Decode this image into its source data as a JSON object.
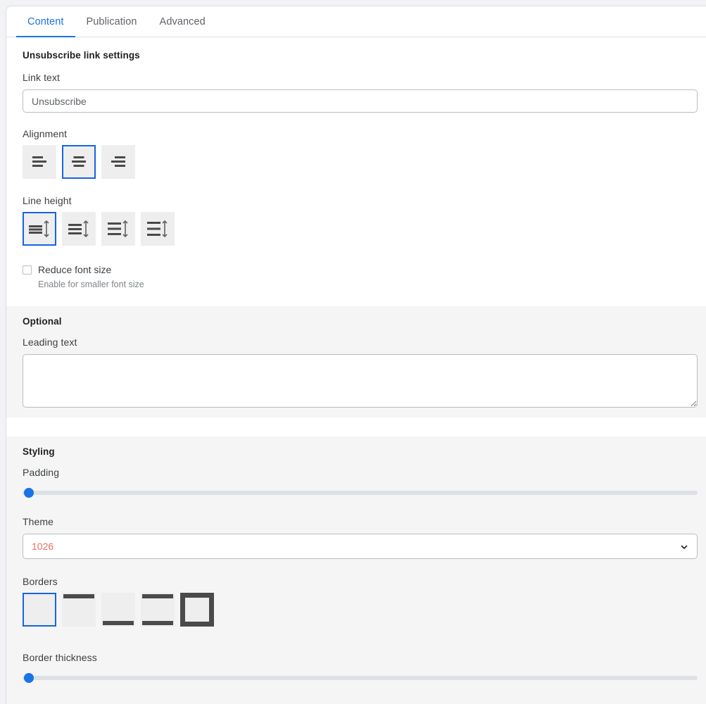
{
  "tabs": [
    {
      "label": "Content",
      "active": true
    },
    {
      "label": "Publication",
      "active": false
    },
    {
      "label": "Advanced",
      "active": false
    }
  ],
  "unsubscribe_section": {
    "title": "Unsubscribe link settings",
    "link_text": {
      "label": "Link text",
      "value": "Unsubscribe",
      "placeholder": "Unsubscribe"
    },
    "alignment": {
      "label": "Alignment",
      "options": [
        "align-left",
        "align-center",
        "align-right"
      ],
      "selected_index": 1
    },
    "line_height": {
      "label": "Line height",
      "options": [
        "line-height-1",
        "line-height-2",
        "line-height-3",
        "line-height-4"
      ],
      "selected_index": 0
    },
    "reduce_font": {
      "label": "Reduce font size",
      "help": "Enable for smaller font size",
      "checked": false
    }
  },
  "optional_section": {
    "title": "Optional",
    "leading_text": {
      "label": "Leading text",
      "value": "",
      "placeholder": ""
    }
  },
  "styling_section": {
    "title": "Styling",
    "padding": {
      "label": "Padding",
      "value": 0
    },
    "theme": {
      "label": "Theme",
      "value": "1026"
    },
    "borders": {
      "label": "Borders",
      "options": [
        "border-none",
        "border-top",
        "border-bottom",
        "border-top-bottom",
        "border-all"
      ],
      "selected_index": 0
    },
    "border_thickness": {
      "label": "Border thickness",
      "value": 0
    }
  },
  "colors": {
    "accent": "#1a73e8",
    "selected_outline": "#1565e0",
    "theme_value": "#e8705f",
    "panel_bg": "#f5f5f5",
    "swatch_bg": "#eeeeee",
    "icon_dark": "#4a4a4a"
  }
}
